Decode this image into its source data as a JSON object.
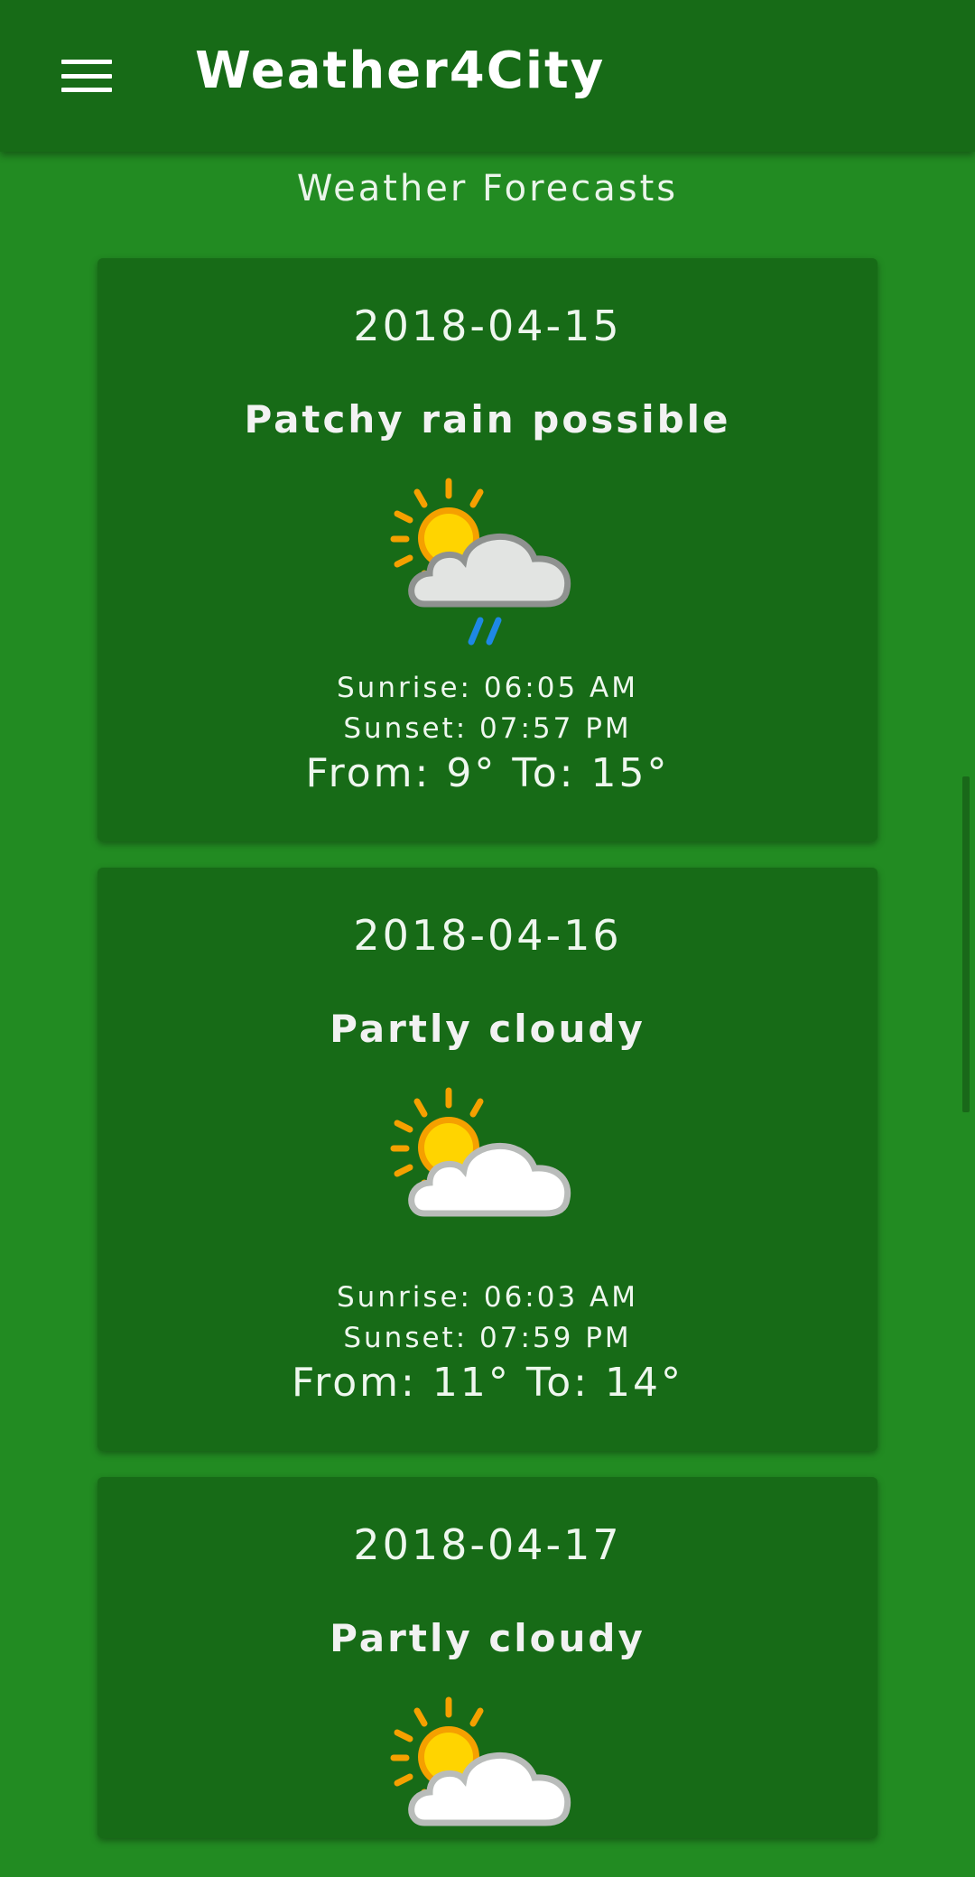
{
  "app_bar": {
    "title": "Weather4City",
    "menu_icon": "hamburger-menu-icon"
  },
  "section_title": "Weather Forecasts",
  "colors": {
    "background": "#228b22",
    "app_bar": "#176b17",
    "card": "#176b17",
    "text": "#ffffff"
  },
  "forecasts": [
    {
      "date": "2018-04-15",
      "condition": "Patchy rain possible",
      "icon": "sun-cloud-rain-icon",
      "sunrise": "Sunrise: 06:05 AM",
      "sunset": "Sunset: 07:57 PM",
      "temp_range": "From: 9° To: 15°"
    },
    {
      "date": "2018-04-16",
      "condition": "Partly cloudy",
      "icon": "sun-cloud-icon",
      "sunrise": "Sunrise: 06:03 AM",
      "sunset": "Sunset: 07:59 PM",
      "temp_range": "From: 11° To: 14°"
    },
    {
      "date": "2018-04-17",
      "condition": "Partly cloudy",
      "icon": "sun-cloud-icon"
    }
  ]
}
